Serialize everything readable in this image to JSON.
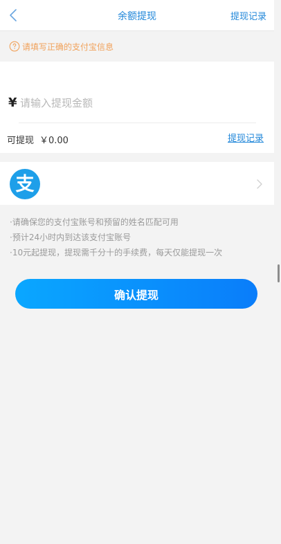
{
  "header": {
    "title": "余额提现",
    "right_link": "提现记录"
  },
  "notice": {
    "text": "请填写正确的支付宝信息"
  },
  "amount": {
    "currency_symbol": "¥",
    "input_value": "",
    "placeholder": "请输入提现金额",
    "available_label": "可提现",
    "available_value": "￥0.00",
    "record_link": "提现记录"
  },
  "account": {
    "logo_glyph": "支",
    "brand_color": "#1e9fe9"
  },
  "tips": [
    "·请确保您的支付宝账号和预留的姓名匹配可用",
    "·预计24小时内到达该支付宝账号",
    "·10元起提现，提现需千分十的手续费，每天仅能提现一次"
  ],
  "confirm_button": {
    "label": "确认提现"
  },
  "colors": {
    "accent": "#1f86d9",
    "warning": "#f1a25b",
    "button_start": "#0aa7ff",
    "button_end": "#0a7dfa"
  },
  "icons": {
    "back": "back-arrow-icon",
    "notice": "question-circle-icon",
    "chevron": "chevron-right-icon",
    "logo": "alipay-logo"
  }
}
